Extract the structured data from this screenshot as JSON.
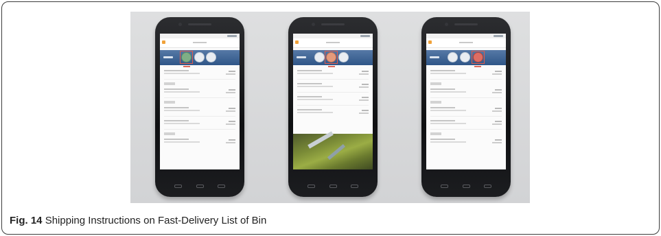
{
  "caption": {
    "label": "Fig. 14",
    "text": "Shipping Instructions on Fast-Delivery List of Bin"
  },
  "phones": [
    {
      "highlighted_icon": 1,
      "icon_colors": [
        "green",
        "",
        ""
      ],
      "has_photo": false
    },
    {
      "highlighted_icon": 1,
      "icon_colors": [
        "",
        "orange",
        ""
      ],
      "has_photo": true
    },
    {
      "highlighted_icon": 2,
      "icon_colors": [
        "",
        "",
        "red"
      ],
      "has_photo": false
    }
  ],
  "colors": {
    "banner": "#2f5688",
    "highlight": "#e15b4c",
    "border": "#3a3a3a"
  }
}
